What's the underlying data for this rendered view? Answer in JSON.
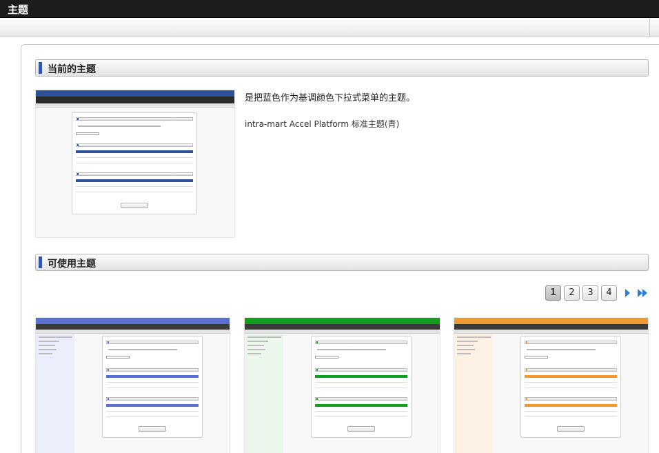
{
  "header": {
    "title": "主题"
  },
  "current_section": {
    "title": "当前的主题",
    "description": "是把蓝色作为基调颜色下拉式菜单的主题。",
    "theme_name": "intra-mart Accel Platform 标准主题(青)"
  },
  "available_section": {
    "title": "可使用主题"
  },
  "pagination": {
    "pages": [
      "1",
      "2",
      "3",
      "4"
    ],
    "current": "1",
    "next_icon": "chevron-right-icon",
    "last_icon": "double-chevron-right-icon"
  },
  "colors": {
    "header_dark": "#1c1c1c",
    "accent_blue": "#2f56a8",
    "theme_blue": "#5a6ed8",
    "theme_green": "#10a020",
    "theme_orange": "#f3982c"
  }
}
